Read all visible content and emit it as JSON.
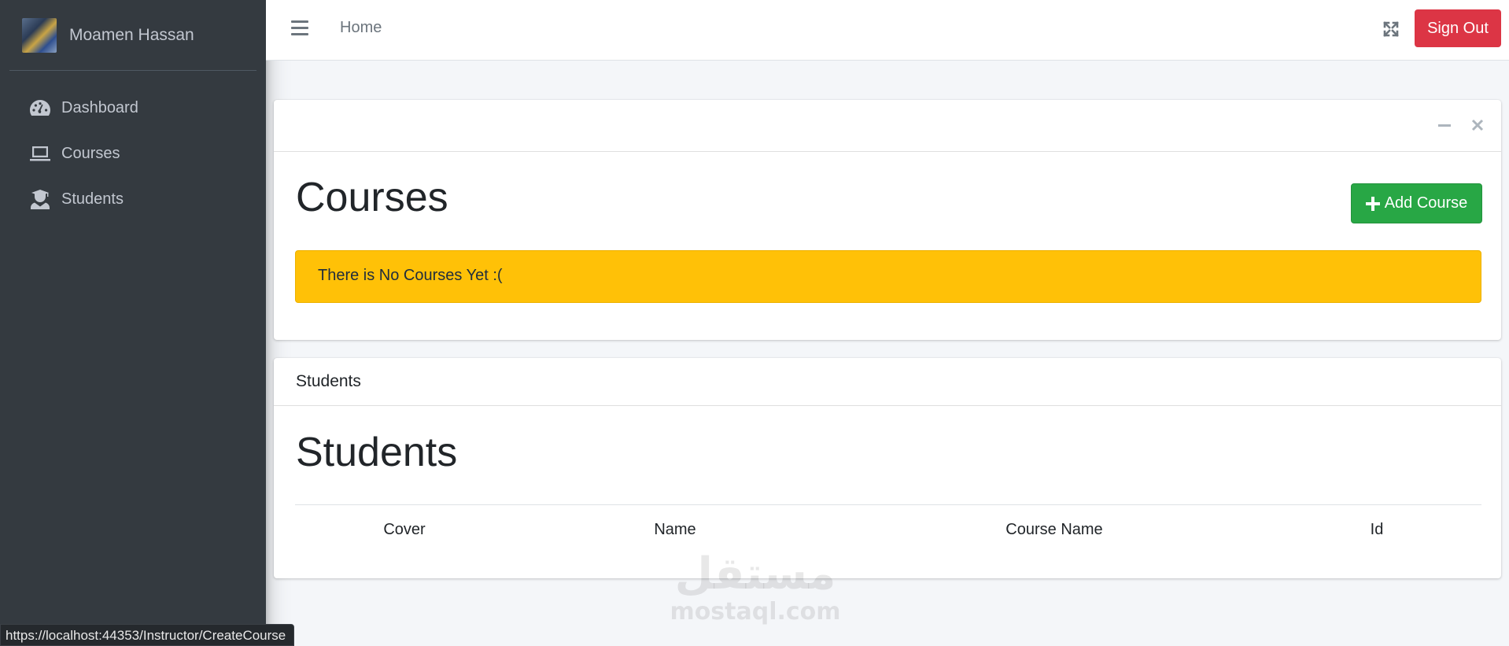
{
  "sidebar": {
    "user_name": "Moamen Hassan",
    "items": [
      {
        "label": "Dashboard",
        "icon": "tachometer-icon"
      },
      {
        "label": "Courses",
        "icon": "laptop-icon"
      },
      {
        "label": "Students",
        "icon": "user-graduate-icon"
      }
    ]
  },
  "topbar": {
    "home_label": "Home",
    "signout_label": "Sign Out"
  },
  "courses_card": {
    "title": "Courses",
    "add_button_label": "Add Course",
    "empty_message": "There is No Courses Yet :("
  },
  "students_card": {
    "header_label": "Students",
    "title": "Students",
    "columns": [
      "Cover",
      "Name",
      "Course Name",
      "Id"
    ]
  },
  "watermark": {
    "arabic": "مستقل",
    "latin": "mostaql.com"
  },
  "status_url": "https://localhost:44353/Instructor/CreateCourse",
  "colors": {
    "sidebar_bg": "#343a40",
    "danger": "#dc3545",
    "success": "#28a745",
    "warning": "#ffc107"
  }
}
